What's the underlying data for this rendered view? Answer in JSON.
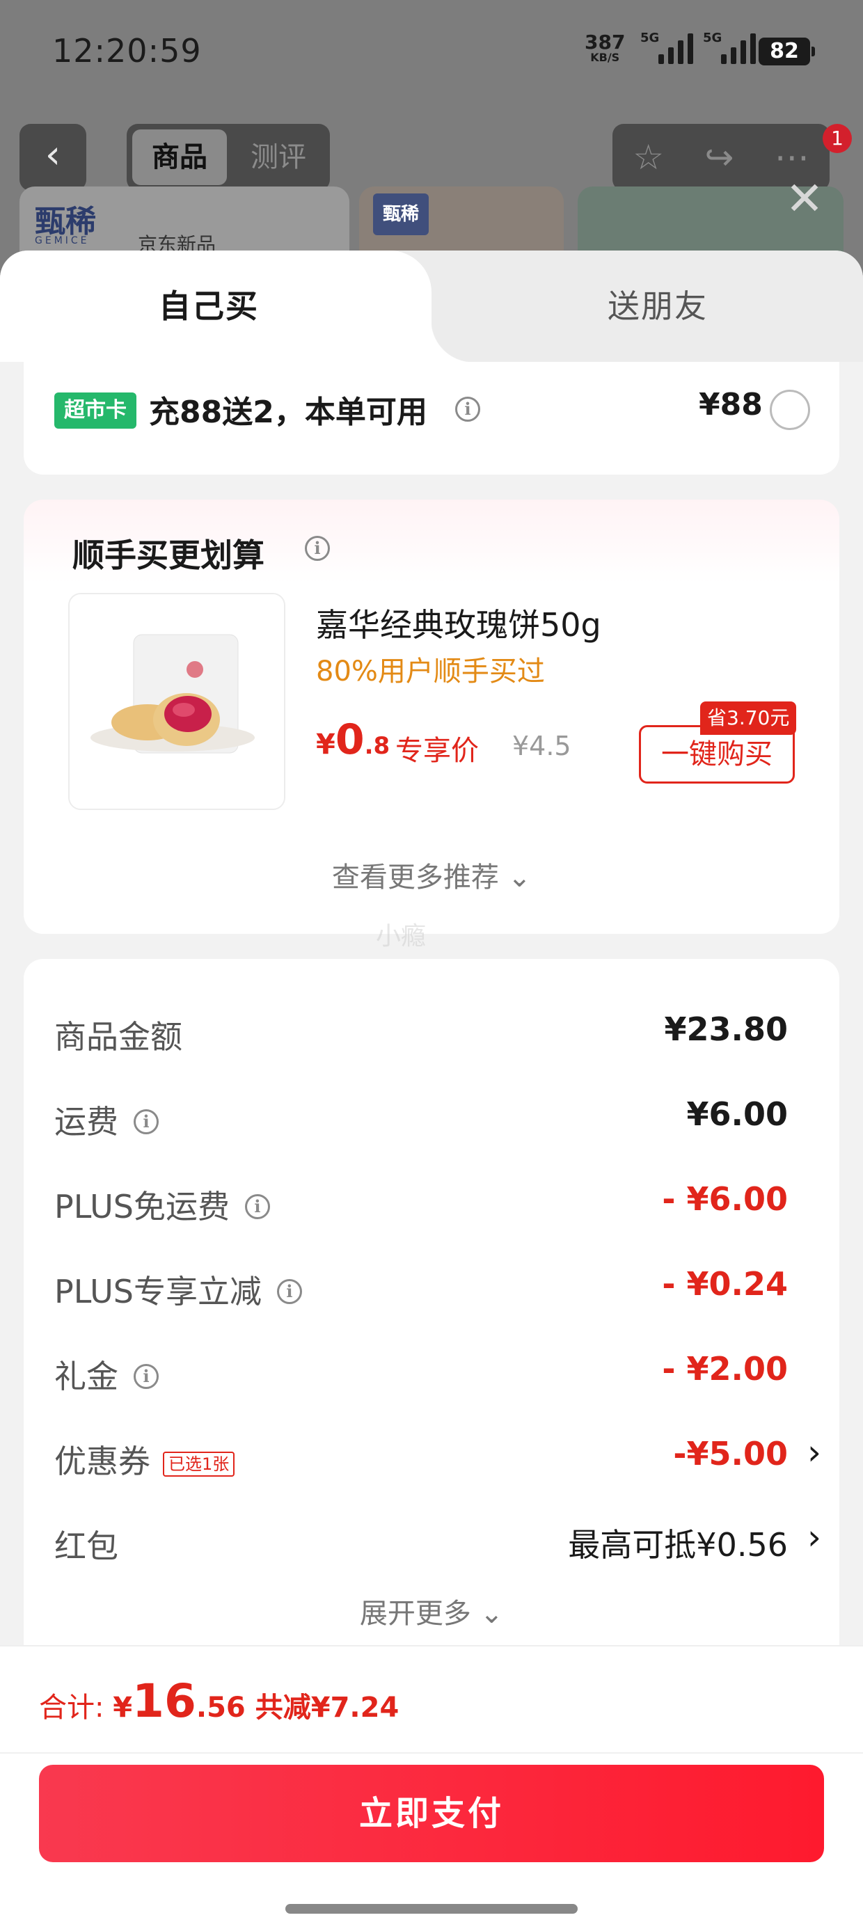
{
  "status_bar": {
    "time": "12:20:59",
    "net_speed": "387",
    "net_unit": "KB/S",
    "signal1_label": "5G",
    "signal2_label": "5G",
    "battery": "82"
  },
  "background_page": {
    "tabs": [
      "商品",
      "测评"
    ],
    "notification_count": "1",
    "brand_name": "甄稀",
    "brand_sub": "GEMICE",
    "jd_label": "京东新品"
  },
  "sheet": {
    "tabs": {
      "self": "自己买",
      "friend": "送朋友"
    },
    "supermarket_card": {
      "chip": "超市卡",
      "text": "充88送2，本单可用",
      "price": "¥88"
    },
    "recommend": {
      "title": "顺手买更划算",
      "product_name": "嘉华经典玫瑰饼50g",
      "tip": "80%用户顺手买过",
      "price_symbol": "¥",
      "price_int": "0",
      "price_dec": ".8",
      "exclusive": "专享价",
      "orig_price": "¥4.5",
      "save_tag": "省3.70元",
      "buy_label": "一键购买",
      "more": "查看更多推荐 ⌄"
    },
    "watermark": "小瘾",
    "summary": {
      "rows": [
        {
          "label": "商品金额",
          "value": "¥23.80"
        },
        {
          "label": "运费",
          "value": "¥6.00"
        },
        {
          "label": "PLUS免运费",
          "value": "- ¥6.00"
        },
        {
          "label": "PLUS专享立减",
          "value": "- ¥0.24"
        },
        {
          "label": "礼金",
          "value": "- ¥2.00"
        },
        {
          "label": "优惠券",
          "tag": "已选1张",
          "value": "-¥5.00"
        },
        {
          "label": "红包",
          "value": "最高可抵¥0.56"
        }
      ],
      "expand": "展开更多 ⌄"
    }
  },
  "footer": {
    "total_label": "合计: ",
    "total_symbol": "¥",
    "total_int": "16",
    "total_dec": ".56",
    "total_cut": "共减¥7.24",
    "pay_label": "立即支付"
  },
  "colors": {
    "accent_red": "#e1251b",
    "green_chip": "#25b86b",
    "tip_orange": "#e38a15"
  }
}
